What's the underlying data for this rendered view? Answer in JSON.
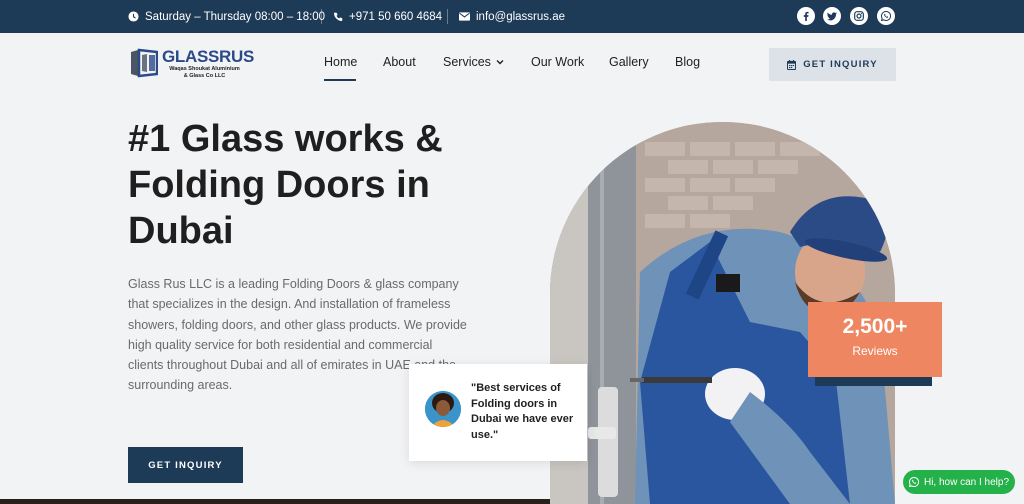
{
  "topbar": {
    "hours": "Saturday – Thursday 08:00 – 18:00",
    "phone": "+971 50 660 4684",
    "email": "info@glassrus.ae",
    "socials": [
      "facebook-icon",
      "twitter-icon",
      "instagram-icon",
      "whatsapp-icon"
    ]
  },
  "logo": {
    "brand": "GLASSRUS",
    "sub_line1": "Waqas Shoukat Aluminium",
    "sub_line2": "& Glass Co LLC"
  },
  "nav": {
    "home": "Home",
    "about": "About",
    "services": "Services",
    "our_work": "Our Work",
    "gallery": "Gallery",
    "blog": "Blog",
    "inquiry": "GET INQUIRY"
  },
  "hero": {
    "title": "#1 Glass works & Folding Doors in Dubai",
    "description": "Glass Rus LLC is a leading Folding Doors  & glass company that specializes in the design. And installation of frameless showers, folding doors, and other glass products. We provide high quality service for both residential and commercial clients throughout Dubai and all of emirates in UAE and the surrounding areas.",
    "cta": "GET INQUIRY"
  },
  "reviews": {
    "count": "2,500+",
    "label": "Reviews"
  },
  "testimonial": {
    "quote": "\"Best services of Folding doors in Dubai we have ever use.\""
  },
  "chat": {
    "label": "Hi, how can I help?"
  },
  "colors": {
    "navy": "#1d3a57",
    "accent": "#ee8761",
    "whatsapp": "#25b14a"
  }
}
